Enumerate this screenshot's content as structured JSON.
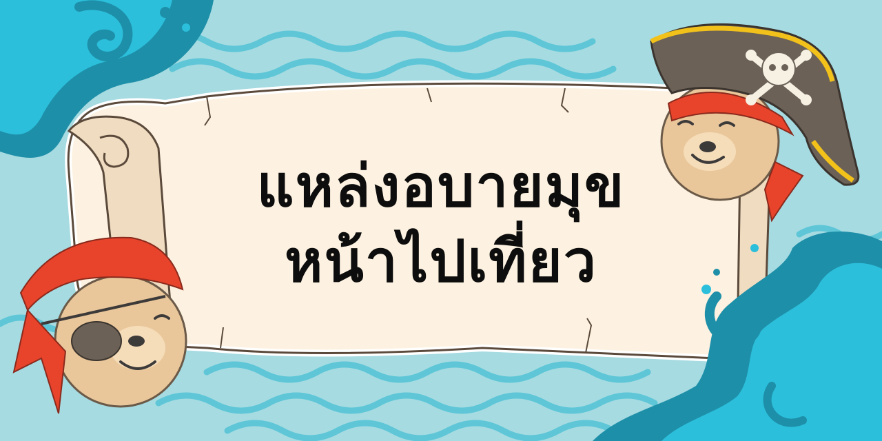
{
  "banner": {
    "title_line1": "แหล่งอบายมุข",
    "title_line2": "หน้าไปเที่ยว"
  },
  "colors": {
    "background": "#a6dbe2",
    "wave_dark": "#1e8fa8",
    "wave_light": "#2bbfdc",
    "scroll_paper": "#fdf2e1",
    "scroll_outline": "#5b4a3b",
    "bandana_red": "#e8442b",
    "hat_brown": "#6b6157",
    "hat_trim": "#f2c21b",
    "bear_fur": "#e9c79b",
    "title_text": "#0d0d0d"
  },
  "icons": [
    "ocean-wave-icon",
    "pirate-bear-icon",
    "pirate-hat-icon",
    "skull-crossbones-icon",
    "eye-patch-icon",
    "scroll-icon"
  ]
}
